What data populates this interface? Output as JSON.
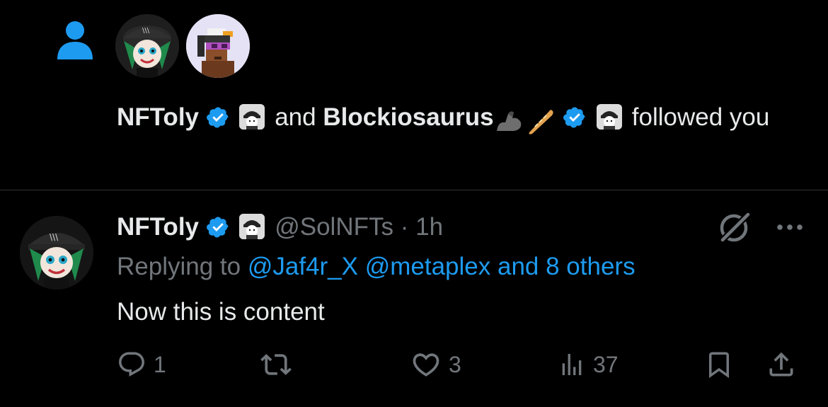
{
  "notification": {
    "icon": "person-icon",
    "users": [
      {
        "name": "NFToly",
        "avatar": "joker-cat-avatar"
      },
      {
        "name": "Blockiosaurus",
        "avatar": "pixel-punk-avatar",
        "emojis": [
          "flexed-biceps",
          "baguette"
        ]
      }
    ],
    "connector": "and",
    "action_text": "followed",
    "trailing_text": "you"
  },
  "tweet": {
    "author_name": "NFToly",
    "handle": "@SolNFTs",
    "separator": "·",
    "time": "1h",
    "replying_prefix": "Replying to",
    "replying_users": "@Jaf4r_X @metaplex",
    "replying_others": "and 8 others",
    "content": "Now this is content",
    "actions": {
      "replies": "1",
      "retweets": "",
      "likes": "3",
      "views": "37"
    }
  },
  "colors": {
    "background": "#000000",
    "accent": "#1d9bf0",
    "muted": "#71767b",
    "text": "#e7e9ea",
    "divider": "#2f3336"
  }
}
